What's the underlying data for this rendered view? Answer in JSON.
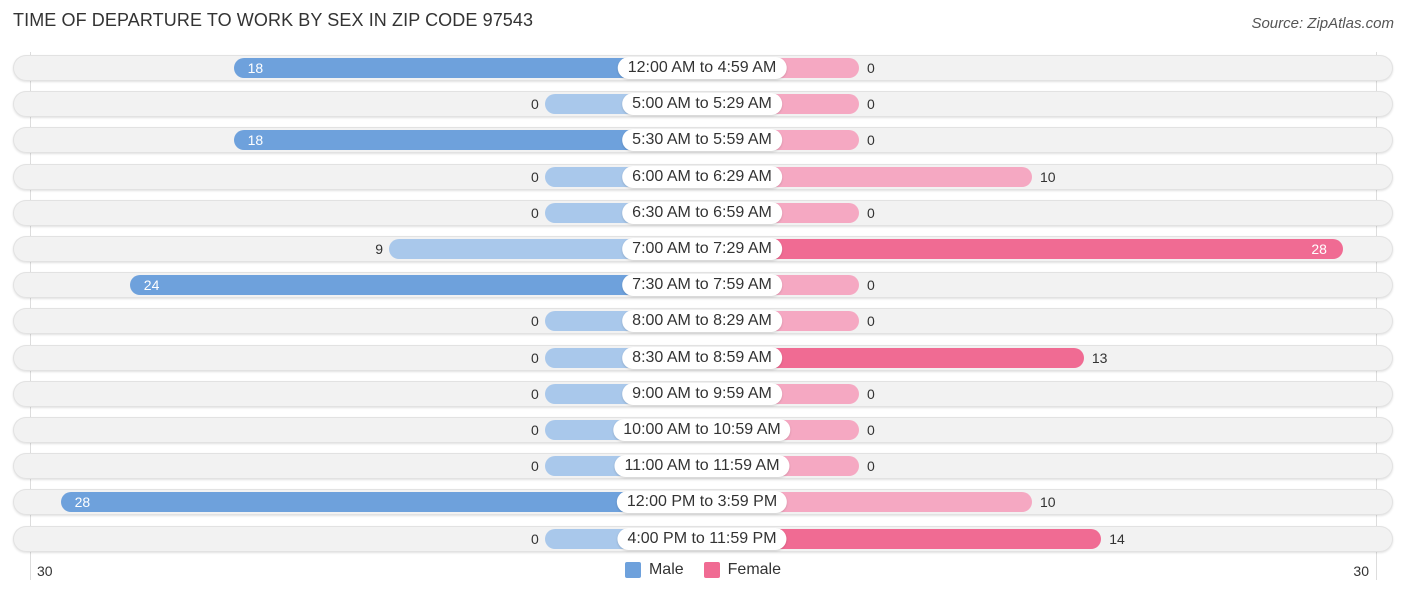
{
  "chart_data": {
    "type": "bar",
    "orientation": "horizontal-diverging",
    "title": "TIME OF DEPARTURE TO WORK BY SEX IN ZIP CODE 97543",
    "source": "Source: ZipAtlas.com",
    "categories": [
      "12:00 AM to 4:59 AM",
      "5:00 AM to 5:29 AM",
      "5:30 AM to 5:59 AM",
      "6:00 AM to 6:29 AM",
      "6:30 AM to 6:59 AM",
      "7:00 AM to 7:29 AM",
      "7:30 AM to 7:59 AM",
      "8:00 AM to 8:29 AM",
      "8:30 AM to 8:59 AM",
      "9:00 AM to 9:59 AM",
      "10:00 AM to 10:59 AM",
      "11:00 AM to 11:59 AM",
      "12:00 PM to 3:59 PM",
      "4:00 PM to 11:59 PM"
    ],
    "series": [
      {
        "name": "Male",
        "color": "#6ea1dc",
        "light_color": "#a9c8eb",
        "values": [
          18,
          0,
          18,
          0,
          0,
          9,
          24,
          0,
          0,
          0,
          0,
          0,
          28,
          0
        ]
      },
      {
        "name": "Female",
        "color": "#f06b93",
        "light_color": "#f5a8c2",
        "values": [
          0,
          0,
          0,
          10,
          0,
          28,
          0,
          0,
          13,
          0,
          0,
          0,
          10,
          14
        ]
      }
    ],
    "axis": {
      "left_tick": "30",
      "right_tick": "30",
      "range": [
        0,
        30
      ]
    },
    "legend": {
      "position": "bottom-center",
      "items": [
        "Male",
        "Female"
      ]
    }
  }
}
